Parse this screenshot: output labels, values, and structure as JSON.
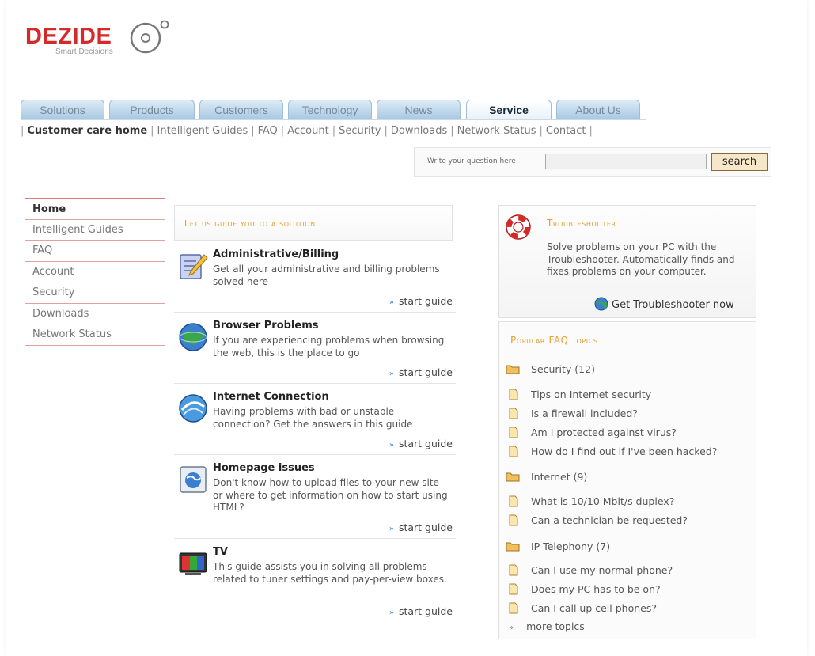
{
  "logo": {
    "name": "DEZIDE",
    "tagline": "Smart Decisions"
  },
  "tabs": [
    {
      "label": "Solutions"
    },
    {
      "label": "Products"
    },
    {
      "label": "Customers"
    },
    {
      "label": "Technology"
    },
    {
      "label": "News"
    },
    {
      "label": "Service",
      "active": true
    },
    {
      "label": "About Us"
    }
  ],
  "subnav": [
    "Customer care home",
    "Intelligent Guides",
    "FAQ",
    "Account",
    "Security",
    "Downloads",
    "Network Status",
    "Contact"
  ],
  "search": {
    "label": "Write your question here",
    "button": "search",
    "value": ""
  },
  "leftnav": [
    "Home",
    "Intelligent Guides",
    "FAQ",
    "Account",
    "Security",
    "Downloads",
    "Network Status"
  ],
  "guide_header": "Let us guide you to a solution",
  "guides": [
    {
      "title": "Administrative/Billing",
      "desc": "Get all your administrative and billing problems solved here",
      "link": "start guide",
      "icon": "billing-pencil-icon"
    },
    {
      "title": "Browser Problems",
      "desc": "If you are experiencing problems when browsing the web, this is the place to go",
      "link": "start guide",
      "icon": "globe-icon"
    },
    {
      "title": "Internet Connection",
      "desc": "Having problems with bad or unstable connection? Get the answers in this guide",
      "link": "start guide",
      "icon": "connection-globe-icon"
    },
    {
      "title": "Homepage issues",
      "desc": "Don't know how to upload files to your new site or where to get information on how to start using HTML?",
      "link": "start guide",
      "icon": "homepage-icon"
    },
    {
      "title": "TV",
      "desc": "This guide assists you in solving all problems related to tuner settings and pay-per-view boxes.",
      "link": "start guide",
      "icon": "tv-icon"
    }
  ],
  "troubleshooter": {
    "title": "Troubleshooter",
    "desc": "Solve problems on your PC with the Troubleshooter. Automatically finds and fixes problems on your computer.",
    "link": "Get Troubleshooter now"
  },
  "faq": {
    "title": "Popular FAQ topics",
    "categories": [
      {
        "name": "Security (12)",
        "questions": [
          "Tips on Internet security",
          "Is a firewall included?",
          "Am I protected against virus?",
          "How do I find out if I've been hacked?"
        ]
      },
      {
        "name": "Internet (9)",
        "questions": [
          "What is 10/10 Mbit/s duplex?",
          "Can a technician be requested?"
        ]
      },
      {
        "name": "IP Telephony (7)",
        "questions": [
          "Can I use my normal phone?",
          "Does my PC has to be on?",
          "Can I call up cell phones?"
        ]
      }
    ],
    "more": "more topics"
  },
  "colors": {
    "brand_red": "#d42a2a",
    "accent_orange": "#e8a030",
    "tab_blue": "#a9c9e3",
    "link_arrow_blue": "#3c82c8"
  }
}
